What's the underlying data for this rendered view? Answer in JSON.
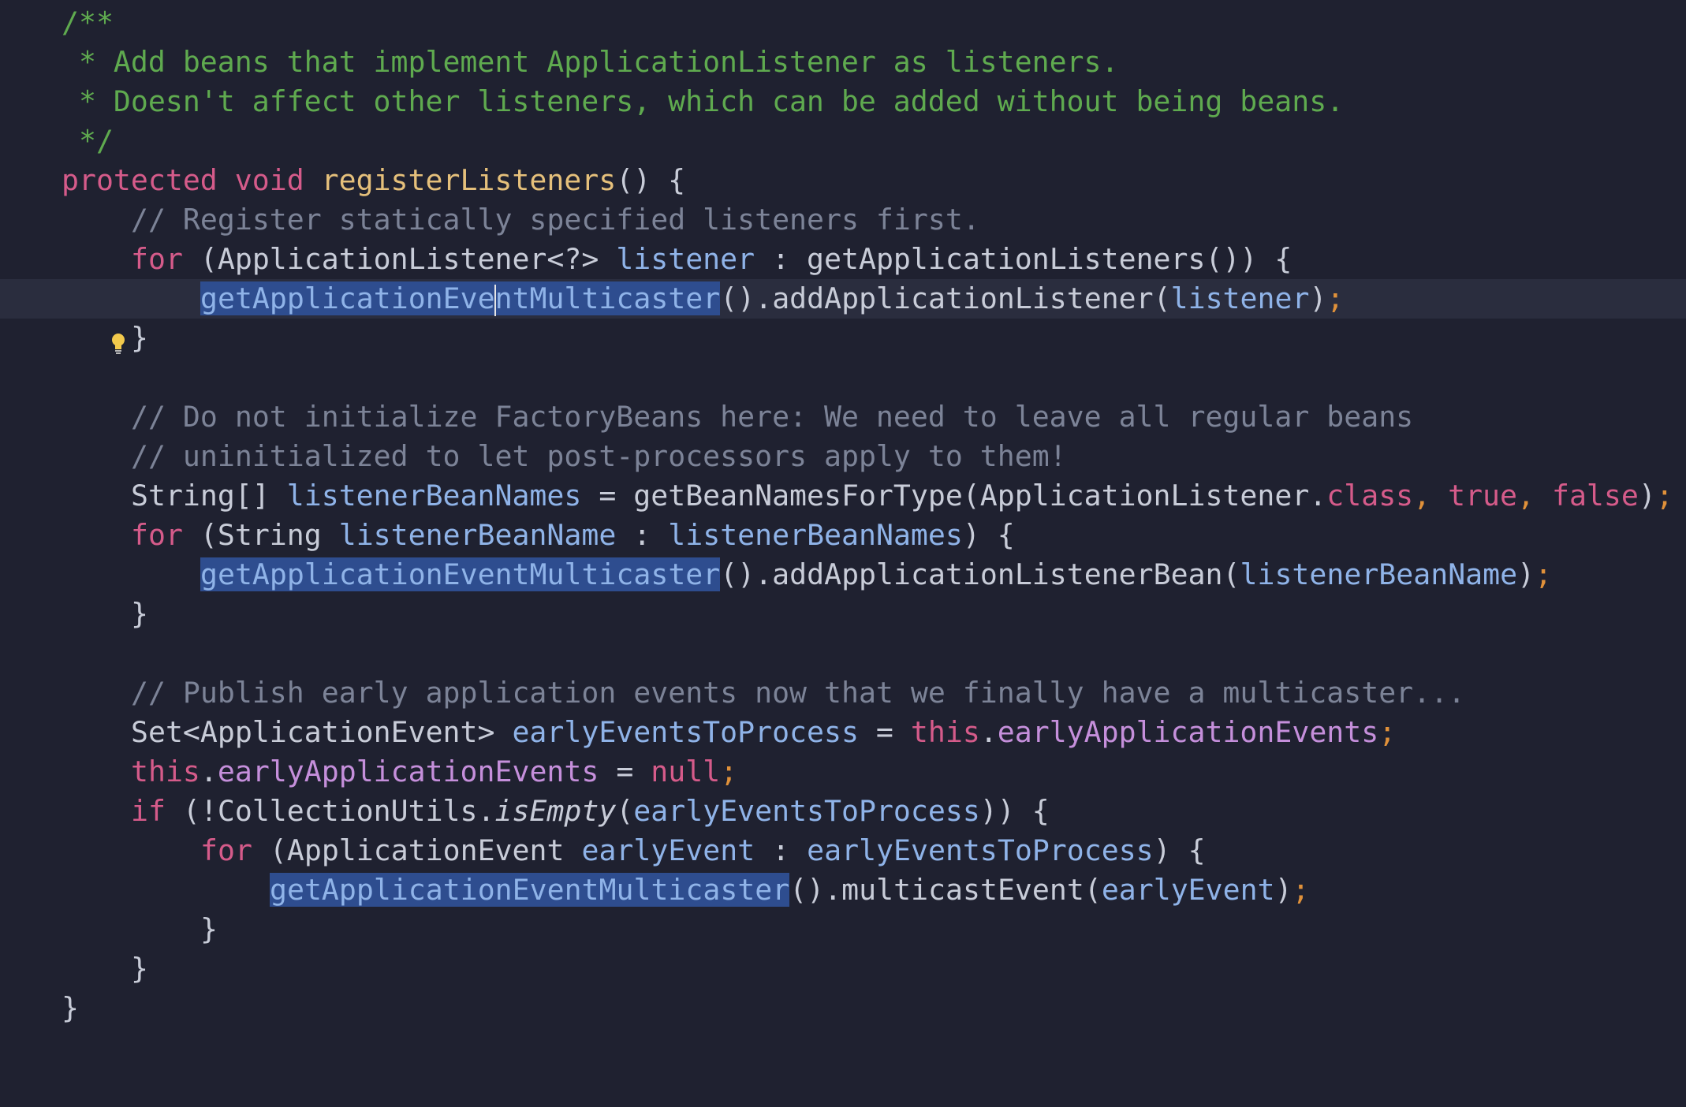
{
  "code": {
    "doc_open": "/**",
    "doc_line1": " * Add beans that implement ApplicationListener as listeners.",
    "doc_line2": " * Doesn't affect other listeners, which can be added without being beans.",
    "doc_close": " */",
    "kw_protected": "protected",
    "kw_void": "void",
    "method_name": "registerListeners",
    "method_tail": "() {",
    "comment_register": "// Register statically specified listeners first.",
    "kw_for": "for",
    "for1_type": " (ApplicationListener<?> ",
    "var_listener": "listener",
    "for1_colon_call": " : getApplicationListeners()) {",
    "multicaster_sel_a": "getApplicationEve",
    "multicaster_sel_b": "ntMulticaster",
    "multicaster_full": "getApplicationEventMulticaster",
    "add_listener_call": "().addApplicationListener(",
    "close_paren": ")",
    "semicolon": ";",
    "close_brace": "}",
    "comment_factory1": "// Do not initialize FactoryBeans here: We need to leave all regular beans",
    "comment_factory2": "// uninitialized to let post-processors apply to them!",
    "string_array_type": "String[] ",
    "var_listener_bean_names": "listenerBeanNames",
    "bean_names_call": " = getBeanNamesForType(ApplicationListener.",
    "kw_class": "class",
    "comma_sep": ", ",
    "kw_true": "true",
    "kw_false": "false",
    "close_paren_plain": ")",
    "for2_type": " (String ",
    "var_listener_bean_name": "listenerBeanName",
    "for2_colon": " : ",
    "for_close": ") {",
    "add_listener_bean_call": "().addApplicationListenerBean(",
    "comment_publish": "// Publish early application events now that we finally have a multicaster...",
    "set_type": "Set<ApplicationEvent> ",
    "var_early_events_to_process": "earlyEventsToProcess",
    "assign": " = ",
    "kw_this": "this",
    "dot": ".",
    "field_early_app_events": "earlyApplicationEvents",
    "kw_null": "null",
    "kw_if": "if",
    "if_open": " (!CollectionUtils.",
    "method_is_empty": "isEmpty",
    "open_paren": "(",
    "if_close": ")) {",
    "for3_type": " (ApplicationEvent ",
    "var_early_event": "earlyEvent",
    "multicast_call": "().multicastEvent("
  },
  "colors": {
    "background": "#1f2130",
    "current_line": "#2a2d3e",
    "selection": "#2e4d8f",
    "doc_comment": "#5faa4f",
    "line_comment": "#7c8397",
    "keyword": "#d55b8a",
    "method_declaration": "#e5c07b",
    "local_variable": "#8fb3e8",
    "field": "#c58fdb",
    "semicolon": "#e0913a",
    "lightbulb": "#f2c94c"
  },
  "gutter": {
    "intention_icon": "lightbulb-icon"
  }
}
